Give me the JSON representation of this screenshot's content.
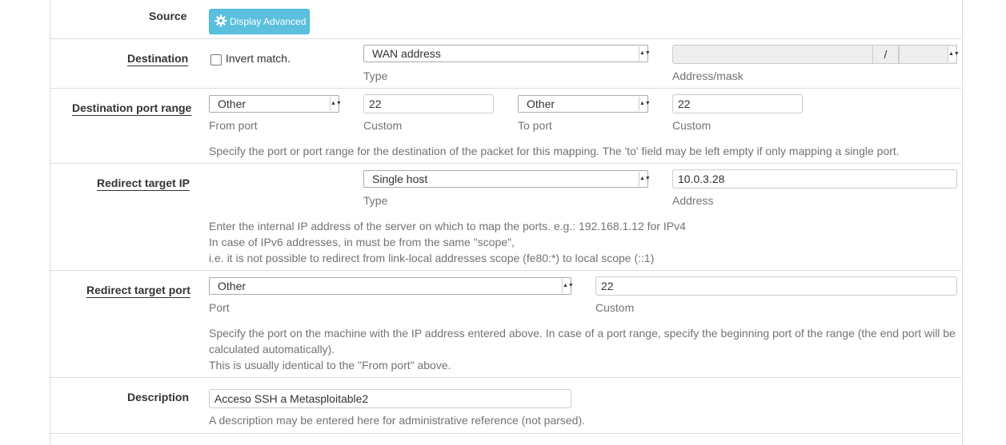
{
  "source": {
    "label": "Source",
    "button": "Display Advanced",
    "icon": "gear-icon"
  },
  "destination": {
    "label": "Destination",
    "invert_label": "Invert match.",
    "type_value": "WAN address",
    "type_hint": "Type",
    "address_hint": "Address/mask",
    "slash": "/"
  },
  "dest_port_range": {
    "label": "Destination port range",
    "from_select": "Other",
    "from_hint": "From port",
    "from_custom": "22",
    "from_custom_hint": "Custom",
    "to_select": "Other",
    "to_hint": "To port",
    "to_custom": "22",
    "to_custom_hint": "Custom",
    "help": "Specify the port or port range for the destination of the packet for this mapping. The 'to' field may be left empty if only mapping a single port."
  },
  "redirect_ip": {
    "label": "Redirect target IP",
    "type_value": "Single host",
    "type_hint": "Type",
    "address_value": "10.0.3.28",
    "address_hint": "Address",
    "help1": "Enter the internal IP address of the server on which to map the ports. e.g.: 192.168.1.12 for IPv4",
    "help2": "In case of IPv6 addresses, in must be from the same \"scope\",",
    "help3": "i.e. it is not possible to redirect from link-local addresses scope (fe80:*) to local scope (::1)"
  },
  "redirect_port": {
    "label": "Redirect target port",
    "port_value": "Other",
    "port_hint": "Port",
    "custom_value": "22",
    "custom_hint": "Custom",
    "help1": "Specify the port on the machine with the IP address entered above. In case of a port range, specify the beginning port of the range (the end port will be calculated automatically).",
    "help2": "This is usually identical to the \"From port\" above."
  },
  "description": {
    "label": "Description",
    "value": "Acceso SSH a Metasploitable2",
    "help": "A description may be entered here for administrative reference (not parsed)."
  },
  "colors": {
    "info_button": "#5bc0de",
    "border": "#dddddd",
    "help_text": "#737373"
  }
}
